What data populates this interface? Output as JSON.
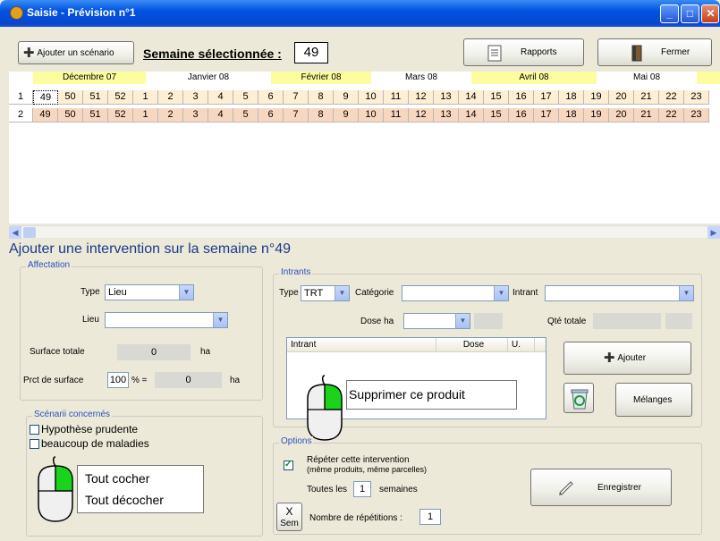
{
  "window": {
    "title": "Saisie - Prévision n°1"
  },
  "toolbar": {
    "add_scenario": "Ajouter un scénario",
    "semaine_label": "Semaine sélectionnée :",
    "semaine_value": "49",
    "reports": "Rapports",
    "close": "Fermer"
  },
  "calendar": {
    "months": [
      "Décembre 07",
      "Janvier 08",
      "Février 08",
      "Mars 08",
      "Avril 08",
      "Mai 08"
    ],
    "row_numbers": [
      "1",
      "2"
    ],
    "weeks": [
      "49",
      "50",
      "51",
      "52",
      "1",
      "2",
      "3",
      "4",
      "5",
      "6",
      "7",
      "8",
      "9",
      "10",
      "11",
      "12",
      "13",
      "14",
      "15",
      "16",
      "17",
      "18",
      "19",
      "20",
      "21",
      "22",
      "23"
    ]
  },
  "heading": "Ajouter une intervention sur la semaine n°49",
  "affectation": {
    "title": "Affectation",
    "type_label": "Type",
    "type_value": "Lieu",
    "lieu_label": "Lieu",
    "lieu_value": "",
    "surface_label": "Surface totale",
    "surface_value": "0",
    "surface_unit": "ha",
    "prct_label": "Prct de surface",
    "prct_value": "100",
    "prct_sign": "% =",
    "prct_result": "0",
    "prct_unit": "ha"
  },
  "scenarii": {
    "title": "Scénarii concernés",
    "items": [
      "Hypothèse prudente",
      "beaucoup de maladies"
    ]
  },
  "context_menu_left": {
    "check_all": "Tout cocher",
    "uncheck_all": "Tout décocher"
  },
  "intrants": {
    "title": "Intrants",
    "type_label": "Type",
    "type_value": "TRT",
    "categorie_label": "Catégorie",
    "intrant_label": "Intrant",
    "dose_label": "Dose ha",
    "qte_label": "Qté totale",
    "col_intrant": "Intrant",
    "col_dose": "Dose",
    "col_u": "U.",
    "add": "Ajouter",
    "melanges": "Mélanges"
  },
  "context_menu_right": {
    "delete_product": "Supprimer ce produit"
  },
  "options": {
    "title": "Options",
    "repeat_label_1": "Répéter cette intervention",
    "repeat_label_2": "(même produits, même parcelles)",
    "every_label": "Toutes les",
    "every_value": "1",
    "weeks_label": "semaines",
    "x_label": "X",
    "sem_label": "Sem",
    "nb_label": "Nombre de répétitions :",
    "nb_value": "1",
    "save": "Enregistrer"
  },
  "colors": {
    "title_bar": "#0054e3",
    "heading": "#1b3a8a",
    "month_highlight": "#fdfda0",
    "row1": "#fcefd3",
    "row2": "#f8d7c0",
    "mouse_button": "#19d31c"
  }
}
